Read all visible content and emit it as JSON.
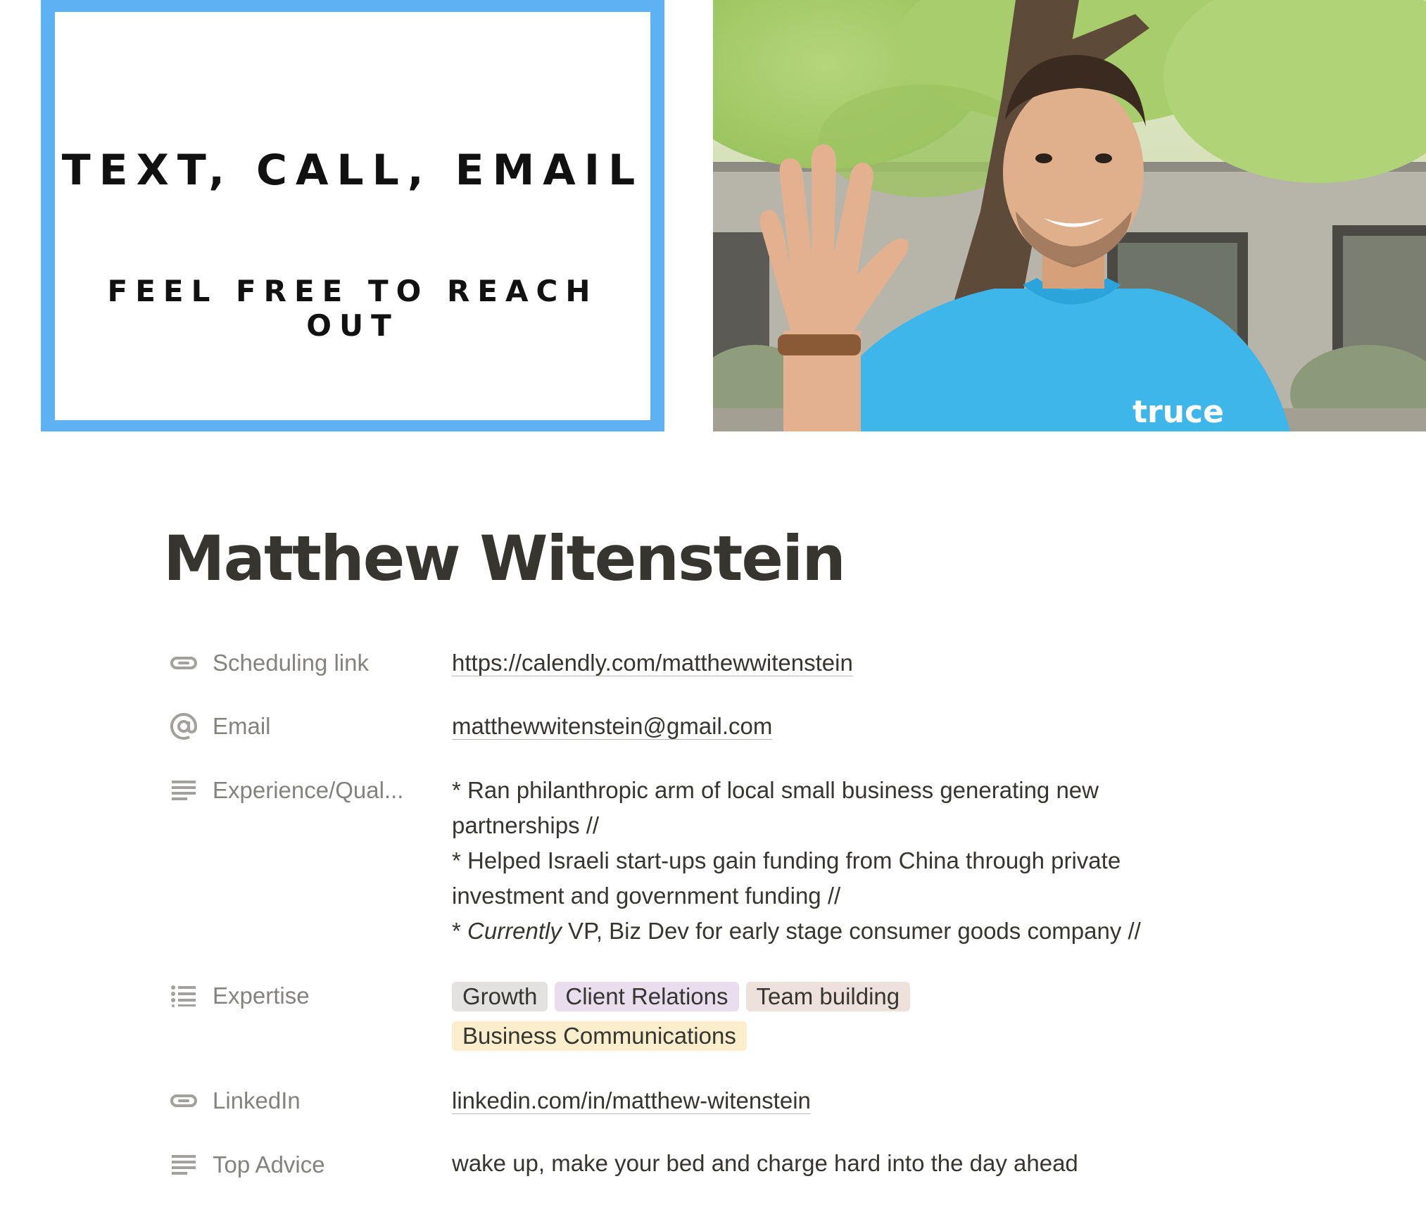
{
  "banner": {
    "line1": "TEXT, CALL, EMAIL",
    "line2": "FEEL FREE TO REACH OUT"
  },
  "photo": {
    "shirt_logo": "truce"
  },
  "title": "Matthew Witenstein",
  "properties": {
    "scheduling": {
      "label": "Scheduling link",
      "icon": "link-icon",
      "value": "https://calendly.com/matthewwitenstein"
    },
    "email": {
      "label": "Email",
      "icon": "at-sign-icon",
      "value": "matthewwitenstein@gmail.com"
    },
    "experience": {
      "label": "Experience/Qual...",
      "icon": "text-lines-icon",
      "lines": [
        "* Ran philanthropic arm of local small business generating new",
        "partnerships  //",
        "* Helped Israeli start-ups gain funding from China through private",
        "investment and government funding //"
      ],
      "line5_prefix": "* ",
      "line5_italic": "Currently",
      "line5_rest": " VP, Biz Dev for early stage consumer goods company //"
    },
    "expertise": {
      "label": "Expertise",
      "icon": "list-icon",
      "tags": [
        {
          "text": "Growth",
          "color": "#e3e2e0"
        },
        {
          "text": "Client Relations",
          "color": "#e8deee"
        },
        {
          "text": "Team building",
          "color": "#eee0da"
        },
        {
          "text": "Business Communications",
          "color": "#fbeecc"
        }
      ]
    },
    "linkedin": {
      "label": "LinkedIn",
      "icon": "link-icon",
      "value": "linkedin.com/in/matthew-witenstein"
    },
    "advice": {
      "label": "Top Advice",
      "icon": "text-lines-icon",
      "value": "wake up, make your bed and charge hard into the day ahead"
    }
  },
  "colors": {
    "banner_border": "#5eb1f3",
    "text": "#37352f",
    "muted": "#8a8883"
  }
}
